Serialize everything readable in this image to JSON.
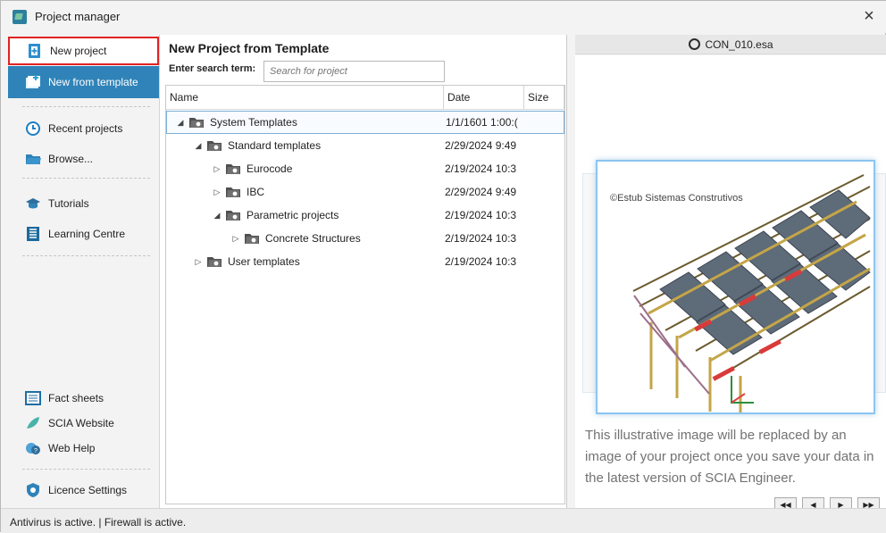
{
  "window": {
    "title": "Project manager"
  },
  "sidebar": {
    "items": [
      {
        "label": "New project"
      },
      {
        "label": "New from template"
      },
      {
        "label": "Recent projects"
      },
      {
        "label": "Browse..."
      },
      {
        "label": "Tutorials"
      },
      {
        "label": "Learning Centre"
      },
      {
        "label": "Fact sheets"
      },
      {
        "label": "SCIA Website"
      },
      {
        "label": "Web Help"
      },
      {
        "label": "Licence Settings"
      }
    ]
  },
  "main": {
    "title": "New Project from Template",
    "search": {
      "label": "Enter search term:",
      "placeholder": "Search for project"
    },
    "columns": [
      "Name",
      "Date",
      "Size"
    ],
    "rows": [
      {
        "name": "System Templates",
        "date": "1/1/1601 1:00:(",
        "level": 0,
        "expand": "◢"
      },
      {
        "name": "Standard templates",
        "date": "2/29/2024 9:49",
        "level": 1,
        "expand": "◢"
      },
      {
        "name": "Eurocode",
        "date": "2/19/2024 10:3",
        "level": 2,
        "expand": "▷"
      },
      {
        "name": "IBC",
        "date": "2/29/2024 9:49",
        "level": 2,
        "expand": "▷"
      },
      {
        "name": "Parametric projects",
        "date": "2/19/2024 10:3",
        "level": 2,
        "expand": "◢"
      },
      {
        "name": "Concrete Structures",
        "date": "2/19/2024 10:3",
        "level": 3,
        "expand": "▷"
      },
      {
        "name": "User templates",
        "date": "2/19/2024 10:3",
        "level": 1,
        "expand": "▷"
      }
    ]
  },
  "preview": {
    "file": "CON_010.esa",
    "watermark": "©Estub Sistemas Construtivos",
    "description": "This illustrative image will be replaced by an image of your project once you save your data in the latest version of SCIA Engineer.",
    "buttons": [
      "◀◀",
      "◀",
      "▶",
      "▶▶"
    ]
  },
  "statusbar": {
    "text": "Antivirus is active.   |   Firewall is active."
  },
  "colors": {
    "accent": "#2f83b8",
    "selection_border": "#e02323"
  }
}
